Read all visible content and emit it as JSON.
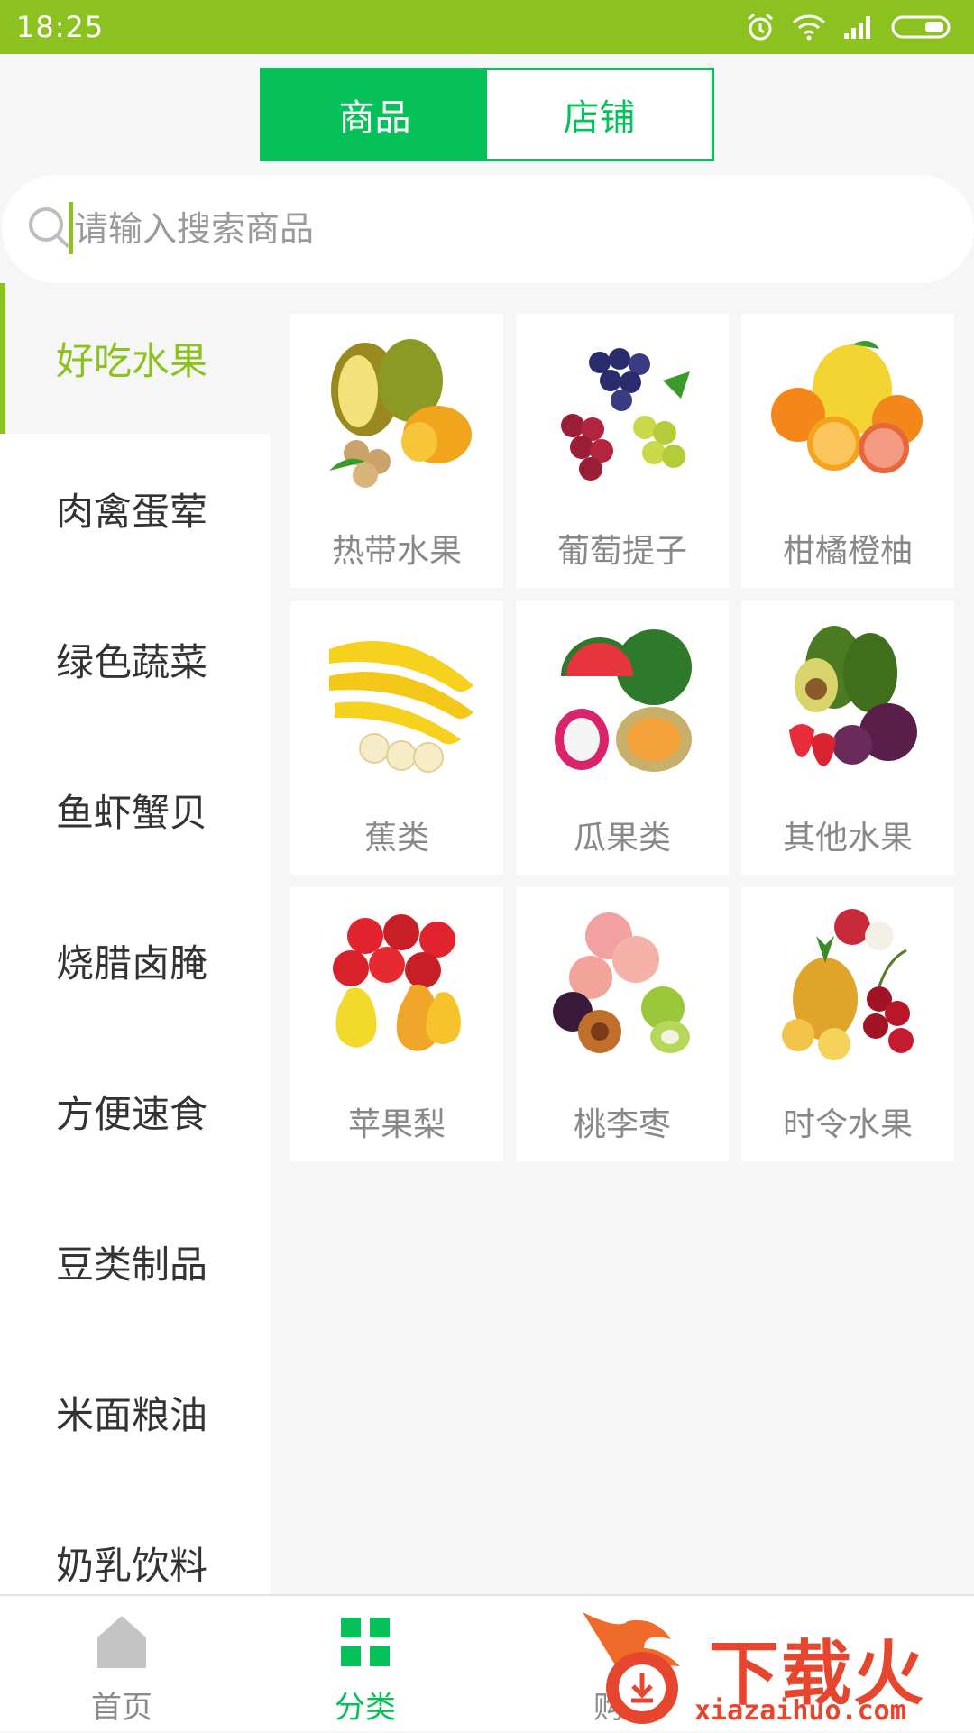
{
  "status_bar": {
    "time": "18:25"
  },
  "toggle": {
    "goods_label": "商品",
    "shops_label": "店铺"
  },
  "search": {
    "placeholder": "请输入搜索商品"
  },
  "sidebar": {
    "items": [
      {
        "label": "好吃水果",
        "active": true
      },
      {
        "label": "肉禽蛋荤",
        "active": false
      },
      {
        "label": "绿色蔬菜",
        "active": false
      },
      {
        "label": "鱼虾蟹贝",
        "active": false
      },
      {
        "label": "烧腊卤腌",
        "active": false
      },
      {
        "label": "方便速食",
        "active": false
      },
      {
        "label": "豆类制品",
        "active": false
      },
      {
        "label": "米面粮油",
        "active": false
      },
      {
        "label": "奶乳饮料",
        "active": false
      }
    ]
  },
  "categories": [
    {
      "label": "热带水果",
      "image": "tropical-fruit-image"
    },
    {
      "label": "葡萄提子",
      "image": "grapes-image"
    },
    {
      "label": "柑橘橙柚",
      "image": "citrus-image"
    },
    {
      "label": "蕉类",
      "image": "banana-image"
    },
    {
      "label": "瓜果类",
      "image": "melon-image"
    },
    {
      "label": "其他水果",
      "image": "other-fruit-image"
    },
    {
      "label": "苹果梨",
      "image": "apple-pear-image"
    },
    {
      "label": "桃李枣",
      "image": "peach-plum-image"
    },
    {
      "label": "时令水果",
      "image": "seasonal-fruit-image"
    }
  ],
  "tabbar": {
    "home_label": "首页",
    "category_label": "分类",
    "cart_label": "购"
  },
  "watermark": {
    "text": "下载火",
    "url": "xiazaihuo.com"
  },
  "colors": {
    "status_bar": "#8cc21f",
    "primary_green": "#06c15a",
    "sidebar_active": "#8cc21f",
    "watermark_red": "#e6462e"
  }
}
